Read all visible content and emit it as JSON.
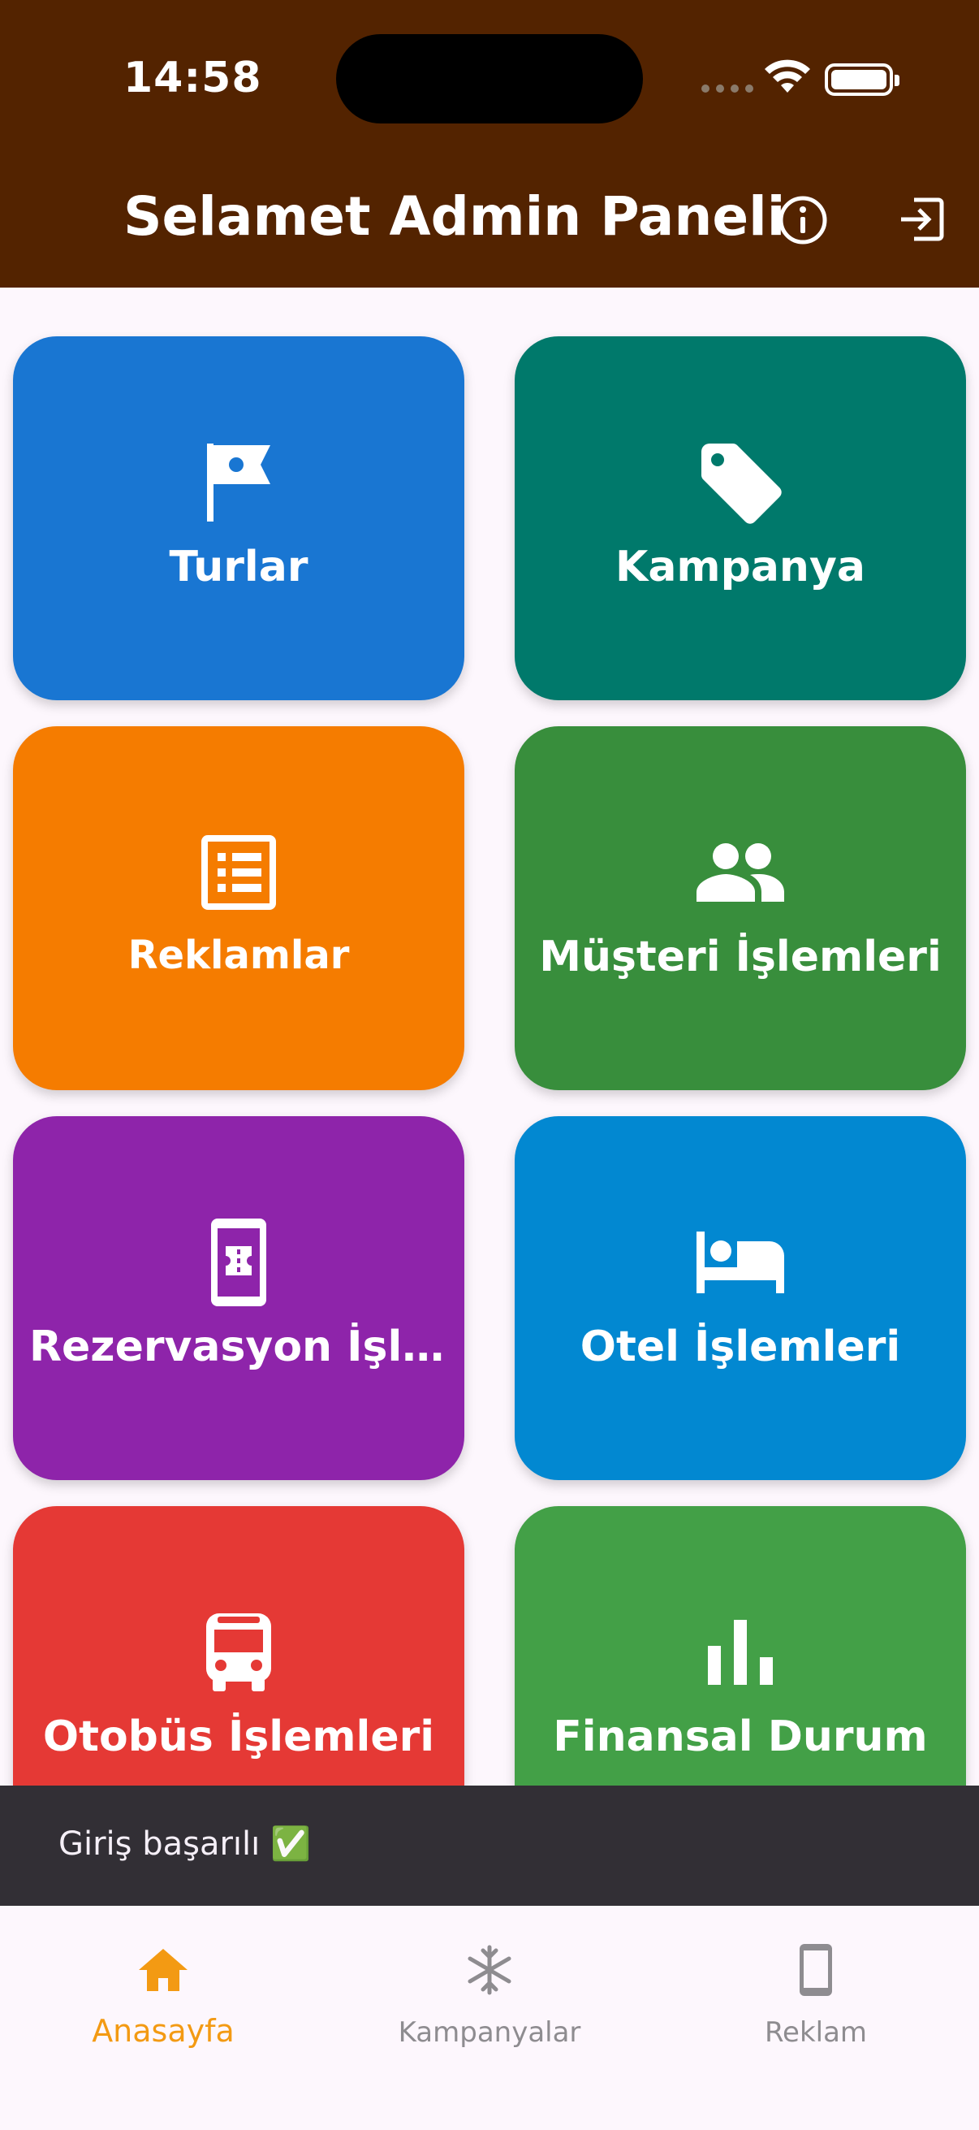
{
  "status_bar": {
    "time": "14:58"
  },
  "app_bar": {
    "title": "Selamet Admin Paneli",
    "info_icon": "info-icon",
    "logout_icon": "logout-icon"
  },
  "tiles": [
    {
      "label": "Turlar",
      "icon": "flag-icon",
      "color": "#1976D2"
    },
    {
      "label": "Kampanya",
      "icon": "tag-icon",
      "color": "#00796B"
    },
    {
      "label": "Reklamlar",
      "icon": "list-alt-icon",
      "color": "#F57C00"
    },
    {
      "label": "Müşteri İşlemleri",
      "icon": "people-icon",
      "color": "#388E3C"
    },
    {
      "label": "Rezervasyon İşlemleri",
      "icon": "ticket-phone-icon",
      "color": "#8E24AA"
    },
    {
      "label": "Otel İşlemleri",
      "icon": "bed-icon",
      "color": "#0288D1"
    },
    {
      "label": "Otobüs İşlemleri",
      "icon": "bus-icon",
      "color": "#E53935"
    },
    {
      "label": "Finansal Durum",
      "icon": "bar-chart-icon",
      "color": "#43A047"
    }
  ],
  "snackbar": {
    "message": "Giriş başarılı ✅"
  },
  "bottom_nav": {
    "items": [
      {
        "label": "Anasayfa",
        "icon": "home-icon",
        "active": true
      },
      {
        "label": "Kampanyalar",
        "icon": "snowflake-icon",
        "active": false
      },
      {
        "label": "Reklam",
        "icon": "phone-icon",
        "active": false
      }
    ]
  },
  "colors": {
    "app_bar": "#532300",
    "accent": "#F39A13",
    "background": "#FDF7FD",
    "snackbar": "#322F35"
  }
}
